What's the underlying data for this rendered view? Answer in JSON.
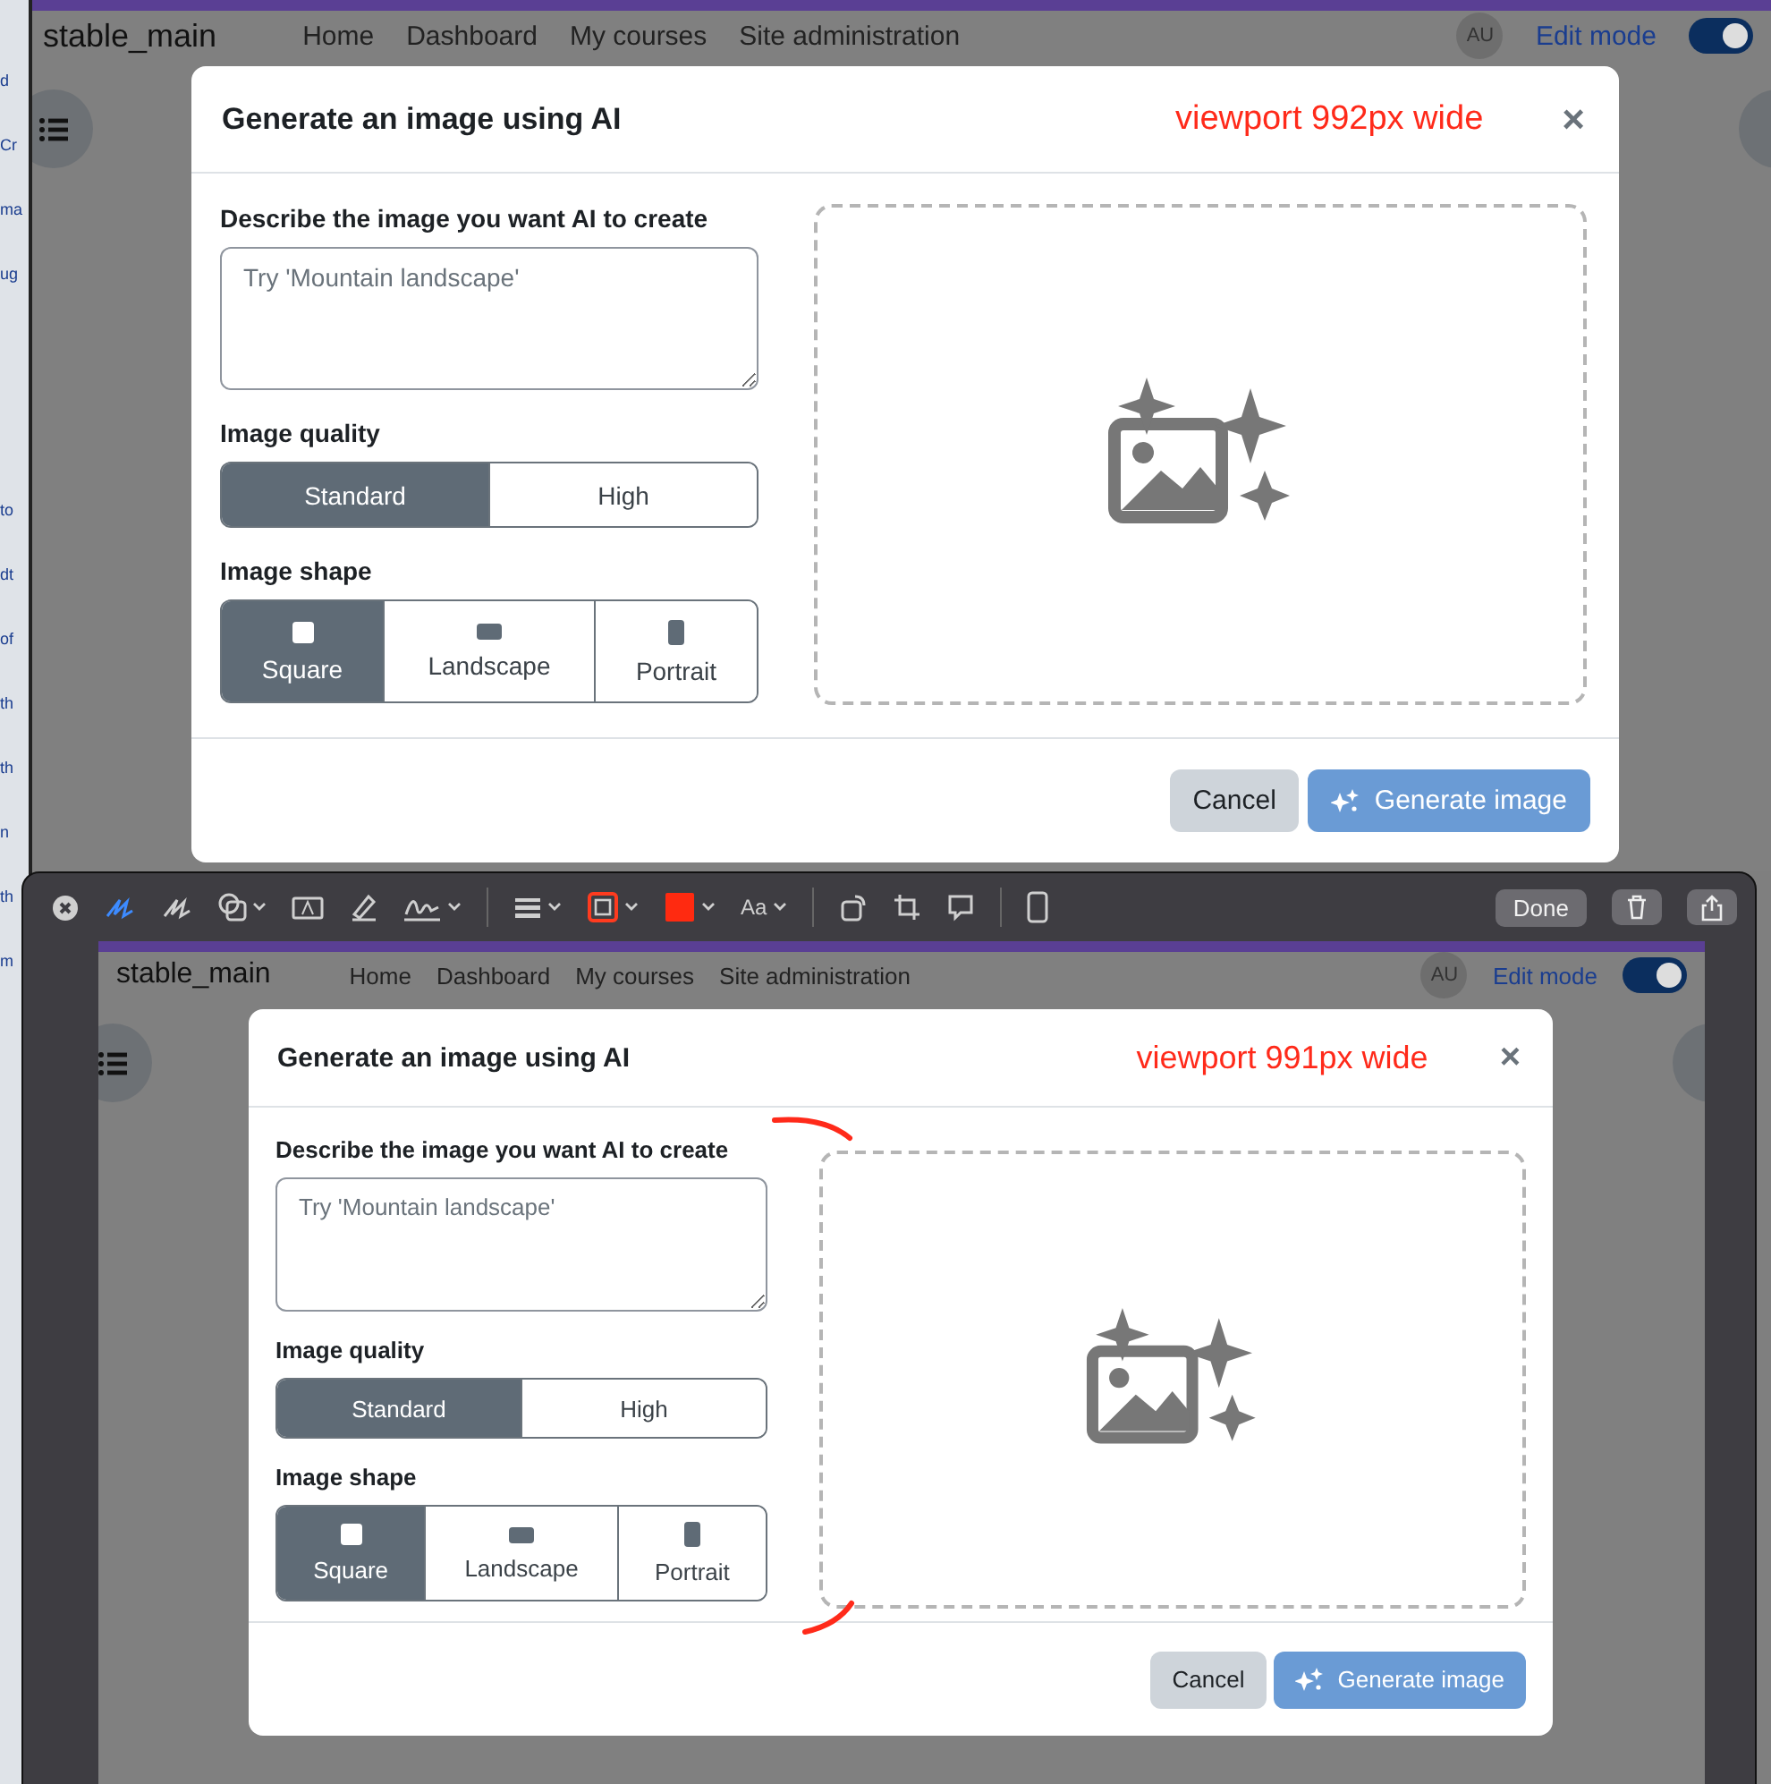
{
  "left_strip": {
    "fragments_top": [
      "d",
      "Cr",
      "ma",
      "ug"
    ],
    "fragments_bottom": [
      "to",
      "dt",
      "of",
      "th",
      "th",
      "n",
      "th",
      "m"
    ]
  },
  "markup_toolbar": {
    "tools": [
      {
        "kind": "close",
        "selected": false
      },
      {
        "kind": "pen",
        "selected": true
      },
      {
        "kind": "sketch",
        "selected": false
      },
      {
        "kind": "shapes",
        "selected": false
      },
      {
        "kind": "textbox",
        "selected": false
      },
      {
        "kind": "highlight",
        "selected": false
      },
      {
        "kind": "signature",
        "selected": false
      },
      {
        "kind": "divider"
      },
      {
        "kind": "lines",
        "selected": false
      },
      {
        "kind": "border",
        "selected": false
      },
      {
        "kind": "fill",
        "selected": false
      },
      {
        "kind": "font",
        "label": "Aa",
        "selected": false
      },
      {
        "kind": "divider"
      },
      {
        "kind": "rotate",
        "selected": false
      },
      {
        "kind": "crop",
        "selected": false
      },
      {
        "kind": "comment",
        "selected": false
      },
      {
        "kind": "divider"
      },
      {
        "kind": "device",
        "selected": false
      }
    ],
    "done": "Done"
  },
  "screens": [
    {
      "header": {
        "site": "stable_main",
        "nav": [
          "Home",
          "Dashboard",
          "My courses",
          "Site administration"
        ],
        "avatar": "AU",
        "edit_mode": {
          "label": "Edit mode",
          "on": true
        }
      },
      "dialog": {
        "title": "Generate an image using AI",
        "annotation": "viewport 992px wide",
        "close": "×",
        "prompt_label": "Describe the image you want AI to create",
        "placeholder": "Try 'Mountain landscape'",
        "quality_label": "Image quality",
        "quality_options": [
          {
            "label": "Standard",
            "selected": true
          },
          {
            "label": "High",
            "selected": false
          }
        ],
        "shape_label": "Image shape",
        "shape_options": [
          {
            "label": "Square",
            "kind": "square",
            "selected": true
          },
          {
            "label": "Landscape",
            "kind": "landscape",
            "selected": false
          },
          {
            "label": "Portrait",
            "kind": "portrait",
            "selected": false
          }
        ],
        "buttons": [
          {
            "label": "Cancel",
            "kind": "secondary"
          },
          {
            "label": "Generate image",
            "kind": "primary"
          }
        ]
      }
    },
    {
      "header": {
        "site": "stable_main",
        "nav": [
          "Home",
          "Dashboard",
          "My courses",
          "Site administration"
        ],
        "avatar": "AU",
        "edit_mode": {
          "label": "Edit mode",
          "on": true
        }
      },
      "dialog": {
        "title": "Generate an image using AI",
        "annotation": "viewport 991px wide",
        "close": "×",
        "prompt_label": "Describe the image you want AI to create",
        "placeholder": "Try 'Mountain landscape'",
        "quality_label": "Image quality",
        "quality_options": [
          {
            "label": "Standard",
            "selected": true
          },
          {
            "label": "High",
            "selected": false
          }
        ],
        "shape_label": "Image shape",
        "shape_options": [
          {
            "label": "Square",
            "kind": "square",
            "selected": true
          },
          {
            "label": "Landscape",
            "kind": "landscape",
            "selected": false
          },
          {
            "label": "Portrait",
            "kind": "portrait",
            "selected": false
          }
        ],
        "buttons": [
          {
            "label": "Cancel",
            "kind": "secondary"
          },
          {
            "label": "Generate image",
            "kind": "primary"
          }
        ]
      }
    }
  ]
}
